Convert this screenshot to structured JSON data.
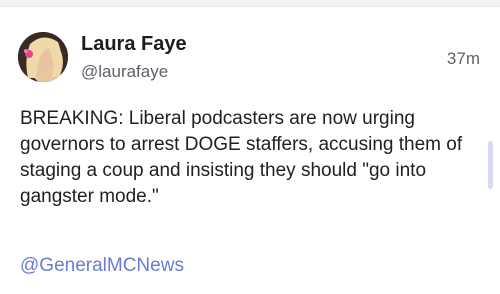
{
  "post": {
    "author_name": "Laura Faye",
    "author_handle": "@laurafaye",
    "timestamp": "37m",
    "body": "BREAKING: Liberal podcasters are now urging governors to arrest DOGE staffers, accusing them of staging a coup and insisting they should \"go into gangster mode.\"",
    "mention": "@GeneralMCNews"
  },
  "colors": {
    "link": "#6a7ccf",
    "text": "#1f1f24",
    "muted": "#5f5f6a",
    "scrollbar": "#d7dbf1"
  }
}
